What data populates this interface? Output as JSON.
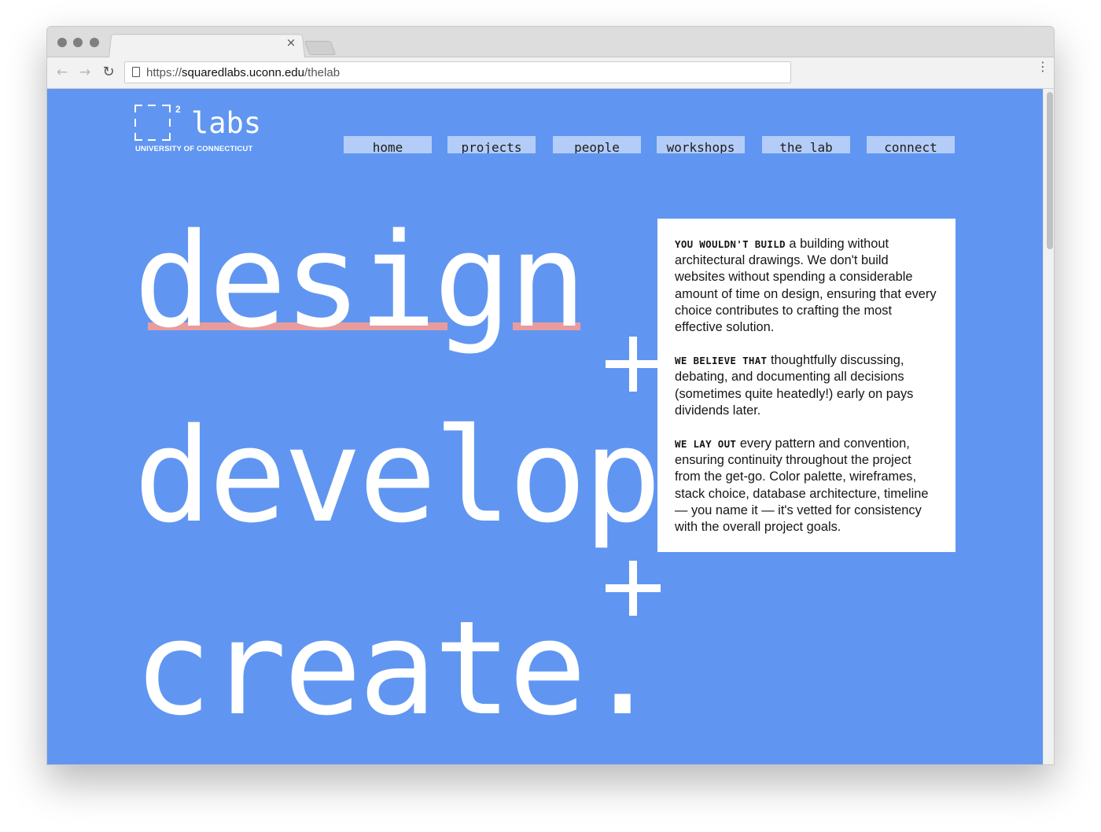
{
  "browser": {
    "tab_close": "×",
    "url_scheme": "https://",
    "url_host": "squaredlabs.uconn.edu",
    "url_path": "/thelab",
    "back_icon": "←",
    "forward_icon": "→",
    "reload_icon": "↻",
    "menu_icon": "⋮"
  },
  "logo": {
    "superscript": "2",
    "word": "labs",
    "university": "UNIVERSITY OF CONNECTICUT"
  },
  "nav": {
    "items": [
      {
        "label": "home"
      },
      {
        "label": "projects"
      },
      {
        "label": "people"
      },
      {
        "label": "workshops"
      },
      {
        "label": "the lab"
      },
      {
        "label": "connect"
      }
    ]
  },
  "hero": {
    "word1": "design",
    "word2": "develop",
    "word3": "create.",
    "plus": "+"
  },
  "colors": {
    "page_bg": "#6096f1",
    "nav_item_bg": "#b3cdf8",
    "underline": "#e89c9d",
    "card_bg": "#ffffff"
  },
  "card": {
    "p1_lead": "YOU WOULDN'T BUILD",
    "p1_text": " a building without architectural drawings.  We don't build websites without spending a considerable amount of time on design, ensuring that every choice contributes to crafting the most effective solution.",
    "p2_lead": "WE BELIEVE THAT",
    "p2_text": " thoughtfully discussing, debating, and documenting all decisions (sometimes quite heatedly!) early on pays dividends later.",
    "p3_lead": "WE LAY OUT",
    "p3_text": " every pattern and convention, ensuring continuity throughout the project from the get-go. Color palette, wireframes, stack choice, database architecture, timeline — you name it — it's vetted for consistency with the overall project goals."
  }
}
